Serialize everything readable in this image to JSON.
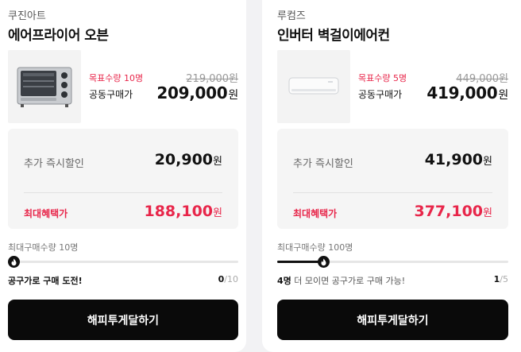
{
  "products": [
    {
      "brand": "쿠진아트",
      "name": "에어프라이어 오븐",
      "image_icon": "air-fryer-oven-icon",
      "target_qty": "목표수량 10명",
      "original_price": "219,000원",
      "group_label": "공동구매가",
      "group_price": "209,000",
      "currency": "원",
      "extra_discount_label": "추가 즉시할인",
      "extra_discount_value": "20,900",
      "max_benefit_label": "최대혜택가",
      "max_benefit_value": "188,100",
      "max_purchase": "최대구매수량 10명",
      "progress": 0.0,
      "status_strong": "",
      "status_text": "공구가로 구매 도전!",
      "count_current": "0",
      "count_total": "/10",
      "cta_label": "해피투게달하기"
    },
    {
      "brand": "루컴즈",
      "name": "인버터 벽걸이에어컨",
      "image_icon": "wall-air-conditioner-icon",
      "target_qty": "목표수량 5명",
      "original_price": "449,000원",
      "group_label": "공동구매가",
      "group_price": "419,000",
      "currency": "원",
      "extra_discount_label": "추가 즉시할인",
      "extra_discount_value": "41,900",
      "max_benefit_label": "최대혜택가",
      "max_benefit_value": "377,100",
      "max_purchase": "최대구매수량 100명",
      "progress": 0.2,
      "status_strong": "4명",
      "status_text": " 더 모이면 공구가로 구매 가능!",
      "count_current": "1",
      "count_total": "/5",
      "cta_label": "해피투게달하기"
    }
  ],
  "colors": {
    "accent_red": "#e8264a",
    "button_bg": "#0a0a0a",
    "card_bg": "#ffffff",
    "panel_bg": "#f5f5f5"
  }
}
